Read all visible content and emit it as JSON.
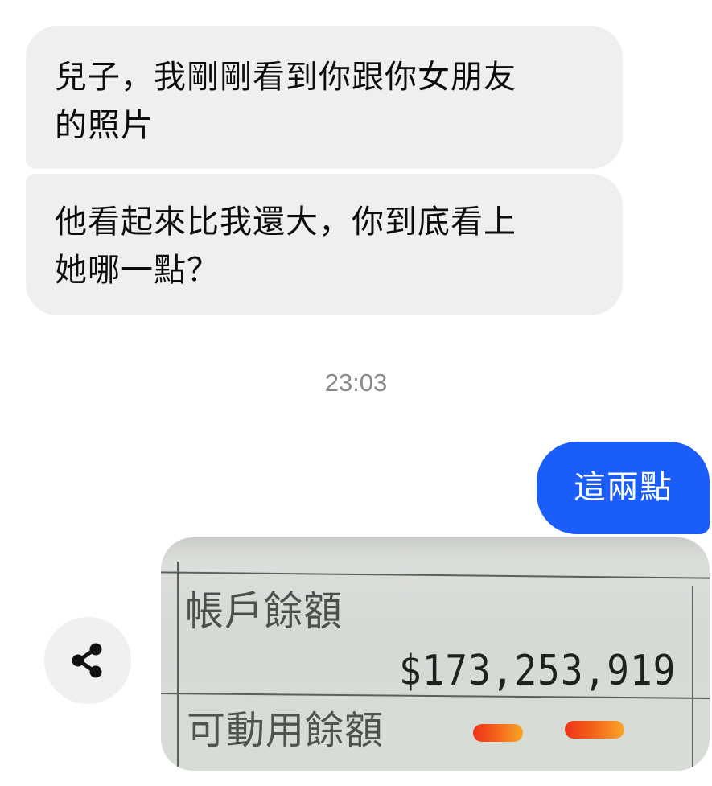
{
  "messages": {
    "incoming": [
      {
        "text_line1": "兒子，我剛剛看到你跟你女朋友",
        "text_line2": "的照片"
      },
      {
        "text_line1": "他看起來比我還大，你到底看上",
        "text_line2": "她哪一點？"
      }
    ],
    "timestamp": "23:03",
    "outgoing": {
      "text": "這兩點"
    }
  },
  "photo": {
    "label_balance": "帳戶餘額",
    "amount": "$173,253,919",
    "label_available": "可動用餘額",
    "redaction_color": "#f45f1a"
  },
  "actions": {
    "share_icon": "share-icon"
  },
  "colors": {
    "incoming_bubble": "#efefef",
    "outgoing_bubble": "#1a5dfa",
    "timestamp": "#8a8a8a"
  }
}
